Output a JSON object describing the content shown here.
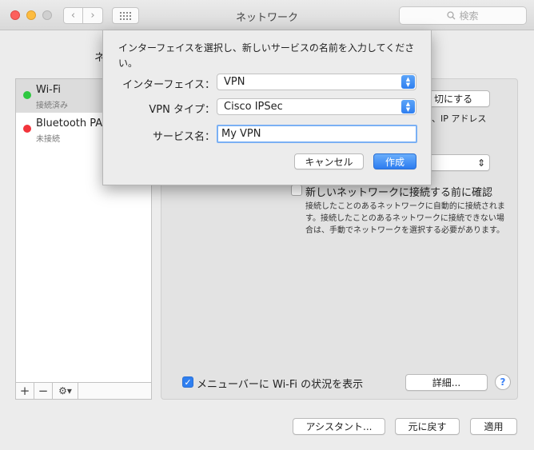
{
  "window": {
    "title": "ネットワーク",
    "search_placeholder": "検索"
  },
  "background": {
    "location_label_partial": "ネ",
    "services": [
      {
        "name": "Wi-Fi",
        "status": "接続済み",
        "color": "#2ec840",
        "selected": true
      },
      {
        "name": "Bluetooth PAN",
        "status": "未接続",
        "color": "#f2343b",
        "selected": false
      }
    ],
    "toolbar": {
      "add": "+",
      "remove": "−",
      "action": "⚙▾"
    },
    "wifi_button": "切にする",
    "ip_text": "、IP アドレス",
    "ask_to_join_label": "新しいネットワークに接続する前に確認",
    "ask_to_join_desc": "接続したことのあるネットワークに自動的に接続されます。接続したことのあるネットワークに接続できない場合は、手動でネットワークを選択する必要があります。",
    "menubar_label": "メニューバーに Wi-Fi の状況を表示",
    "detail_button": "詳細...",
    "help_button": "?",
    "assistant_button": "アシスタント...",
    "revert_button": "元に戻す",
    "apply_button": "適用"
  },
  "sheet": {
    "instruction": "インターフェイスを選択し、新しいサービスの名前を入力してください。",
    "interface_label": "インターフェイス：",
    "interface_value": "VPN",
    "vpn_type_label": "VPN タイプ：",
    "vpn_type_value": "Cisco IPSec",
    "service_name_label": "サービス名：",
    "service_name_value": "My VPN",
    "cancel_button": "キャンセル",
    "create_button": "作成"
  },
  "colors": {
    "accent": "#2f7ff0"
  }
}
